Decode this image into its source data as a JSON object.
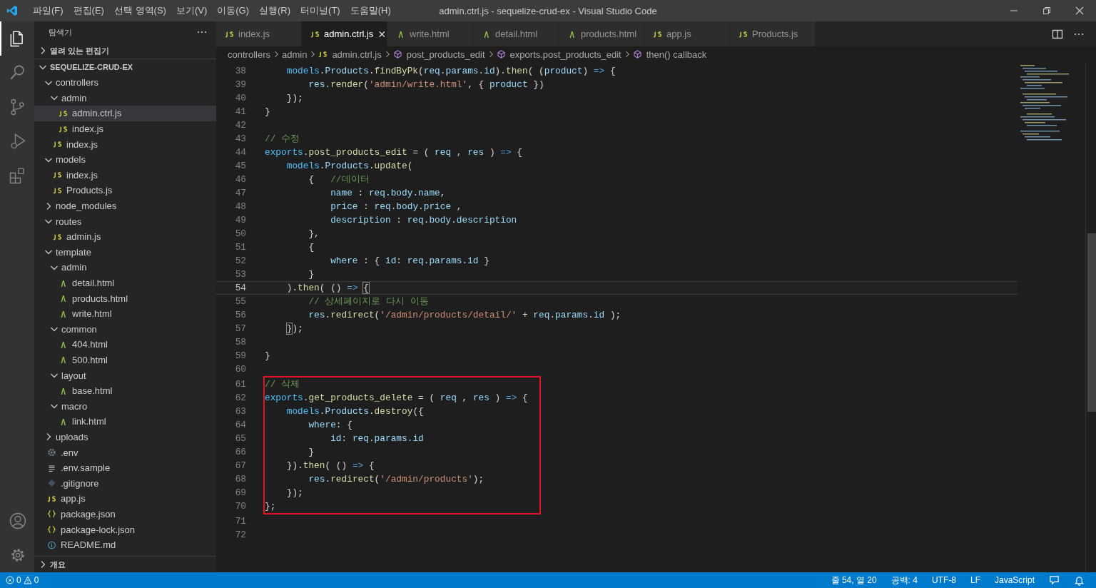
{
  "window": {
    "title": "admin.ctrl.js - sequelize-crud-ex - Visual Studio Code"
  },
  "menu": [
    "파일(F)",
    "편집(E)",
    "선택 영역(S)",
    "보기(V)",
    "이동(G)",
    "실행(R)",
    "터미널(T)",
    "도움말(H)"
  ],
  "activity_bar": [
    {
      "kind": "files",
      "selected": true
    },
    {
      "kind": "search",
      "selected": false
    },
    {
      "kind": "source-control",
      "selected": false
    },
    {
      "kind": "run",
      "selected": false
    },
    {
      "kind": "extensions",
      "selected": false
    }
  ],
  "activity_bottom": [
    {
      "kind": "account"
    },
    {
      "kind": "settings"
    }
  ],
  "sidebar": {
    "title": "탐색기",
    "open_editors": {
      "label": "열려 있는 편집기",
      "expanded": false
    },
    "root": {
      "label": "SEQUELIZE-CRUD-EX",
      "expanded": true
    },
    "items": [
      {
        "label": "controllers",
        "kind": "folder",
        "expanded": true,
        "selected": false,
        "children": [
          {
            "label": "admin",
            "kind": "folder",
            "expanded": true,
            "selected": false,
            "children": [
              {
                "label": "admin.ctrl.js",
                "kind": "js",
                "selected": true
              },
              {
                "label": "index.js",
                "kind": "js",
                "selected": false
              }
            ]
          },
          {
            "label": "index.js",
            "kind": "js",
            "selected": false
          }
        ]
      },
      {
        "label": "models",
        "kind": "folder",
        "expanded": true,
        "selected": false,
        "children": [
          {
            "label": "index.js",
            "kind": "js",
            "selected": false
          },
          {
            "label": "Products.js",
            "kind": "js",
            "selected": false
          }
        ]
      },
      {
        "label": "node_modules",
        "kind": "folder",
        "expanded": false,
        "selected": false
      },
      {
        "label": "routes",
        "kind": "folder",
        "expanded": true,
        "selected": false,
        "children": [
          {
            "label": "admin.js",
            "kind": "js",
            "selected": false
          }
        ]
      },
      {
        "label": "template",
        "kind": "folder",
        "expanded": true,
        "selected": false,
        "children": [
          {
            "label": "admin",
            "kind": "folder",
            "expanded": true,
            "selected": false,
            "children": [
              {
                "label": "detail.html",
                "kind": "html",
                "selected": false
              },
              {
                "label": "products.html",
                "kind": "html",
                "selected": false
              },
              {
                "label": "write.html",
                "kind": "html",
                "selected": false
              }
            ]
          },
          {
            "label": "common",
            "kind": "folder",
            "expanded": true,
            "selected": false,
            "children": [
              {
                "label": "404.html",
                "kind": "html",
                "selected": false
              },
              {
                "label": "500.html",
                "kind": "html",
                "selected": false
              }
            ]
          },
          {
            "label": "layout",
            "kind": "folder",
            "expanded": true,
            "selected": false,
            "children": [
              {
                "label": "base.html",
                "kind": "html",
                "selected": false
              }
            ]
          },
          {
            "label": "macro",
            "kind": "folder",
            "expanded": true,
            "selected": false,
            "children": [
              {
                "label": "link.html",
                "kind": "html",
                "selected": false
              }
            ]
          }
        ]
      },
      {
        "label": "uploads",
        "kind": "folder",
        "expanded": false,
        "selected": false
      },
      {
        "label": ".env",
        "kind": "gear",
        "selected": false
      },
      {
        "label": ".env.sample",
        "kind": "lines",
        "selected": false
      },
      {
        "label": ".gitignore",
        "kind": "git",
        "selected": false
      },
      {
        "label": "app.js",
        "kind": "js",
        "selected": false
      },
      {
        "label": "package.json",
        "kind": "json",
        "selected": false
      },
      {
        "label": "package-lock.json",
        "kind": "json",
        "selected": false
      },
      {
        "label": "README.md",
        "kind": "info",
        "selected": false
      }
    ],
    "outline": {
      "label": "개요",
      "expanded": false
    }
  },
  "tabs": [
    {
      "label": "index.js",
      "kind": "js",
      "selected": false
    },
    {
      "label": "admin.ctrl.js",
      "kind": "js",
      "selected": true
    },
    {
      "label": "write.html",
      "kind": "html",
      "selected": false
    },
    {
      "label": "detail.html",
      "kind": "html",
      "selected": false
    },
    {
      "label": "products.html",
      "kind": "html",
      "selected": false
    },
    {
      "label": "app.js",
      "kind": "js",
      "selected": false
    },
    {
      "label": "Products.js",
      "kind": "js",
      "selected": false
    }
  ],
  "breadcrumbs": [
    {
      "label": "controllers",
      "kind": "none"
    },
    {
      "label": "admin",
      "kind": "none"
    },
    {
      "label": "admin.ctrl.js",
      "kind": "js"
    },
    {
      "label": "post_products_edit",
      "kind": "symbol"
    },
    {
      "label": "exports.post_products_edit",
      "kind": "symbol"
    },
    {
      "label": "then() callback",
      "kind": "symbol"
    }
  ],
  "code_blocks": [
    {
      "boxed": false,
      "lines": [
        {
          "no": "38",
          "current": false,
          "tokens": [
            {
              "text": "    models",
              "kind": "obj"
            },
            {
              "text": ".",
              "kind": "plain"
            },
            {
              "text": "Products",
              "kind": "var"
            },
            {
              "text": ".",
              "kind": "plain"
            },
            {
              "text": "findByPk",
              "kind": "fn"
            },
            {
              "text": "(",
              "kind": "plain"
            },
            {
              "text": "req",
              "kind": "var"
            },
            {
              "text": ".",
              "kind": "plain"
            },
            {
              "text": "params",
              "kind": "var"
            },
            {
              "text": ".",
              "kind": "plain"
            },
            {
              "text": "id",
              "kind": "var"
            },
            {
              "text": ").",
              "kind": "plain"
            },
            {
              "text": "then",
              "kind": "fn"
            },
            {
              "text": "( (",
              "kind": "plain"
            },
            {
              "text": "product",
              "kind": "var"
            },
            {
              "text": ") ",
              "kind": "plain"
            },
            {
              "text": "=>",
              "kind": "op"
            },
            {
              "text": " {",
              "kind": "plain"
            }
          ]
        },
        {
          "no": "39",
          "current": false,
          "tokens": [
            {
              "text": "        res",
              "kind": "var"
            },
            {
              "text": ".",
              "kind": "plain"
            },
            {
              "text": "render",
              "kind": "fn"
            },
            {
              "text": "(",
              "kind": "plain"
            },
            {
              "text": "'admin/write.html'",
              "kind": "str"
            },
            {
              "text": ", { ",
              "kind": "plain"
            },
            {
              "text": "product",
              "kind": "var"
            },
            {
              "text": " })",
              "kind": "plain"
            }
          ]
        },
        {
          "no": "40",
          "current": false,
          "tokens": [
            {
              "text": "    });",
              "kind": "plain"
            }
          ]
        },
        {
          "no": "41",
          "current": false,
          "tokens": [
            {
              "text": "}",
              "kind": "plain"
            }
          ]
        },
        {
          "no": "42",
          "current": false
        },
        {
          "no": "43",
          "current": false,
          "tokens": [
            {
              "text": "// 수정",
              "kind": "cmt"
            }
          ]
        },
        {
          "no": "44",
          "current": false,
          "tokens": [
            {
              "text": "exports",
              "kind": "obj"
            },
            {
              "text": ".",
              "kind": "plain"
            },
            {
              "text": "post_products_edit",
              "kind": "fn"
            },
            {
              "text": " = ( ",
              "kind": "plain"
            },
            {
              "text": "req",
              "kind": "var"
            },
            {
              "text": " , ",
              "kind": "plain"
            },
            {
              "text": "res",
              "kind": "var"
            },
            {
              "text": " ) ",
              "kind": "plain"
            },
            {
              "text": "=>",
              "kind": "op"
            },
            {
              "text": " {",
              "kind": "plain"
            }
          ]
        },
        {
          "no": "45",
          "current": false,
          "tokens": [
            {
              "text": "    models",
              "kind": "obj"
            },
            {
              "text": ".",
              "kind": "plain"
            },
            {
              "text": "Products",
              "kind": "var"
            },
            {
              "text": ".",
              "kind": "plain"
            },
            {
              "text": "update",
              "kind": "fn"
            },
            {
              "text": "(",
              "kind": "plain"
            }
          ]
        },
        {
          "no": "46",
          "current": false,
          "tokens": [
            {
              "text": "        {   ",
              "kind": "plain"
            },
            {
              "text": "//데이터",
              "kind": "cmt"
            }
          ]
        },
        {
          "no": "47",
          "current": false,
          "tokens": [
            {
              "text": "            name",
              "kind": "var"
            },
            {
              "text": " : ",
              "kind": "plain"
            },
            {
              "text": "req",
              "kind": "var"
            },
            {
              "text": ".",
              "kind": "plain"
            },
            {
              "text": "body",
              "kind": "var"
            },
            {
              "text": ".",
              "kind": "plain"
            },
            {
              "text": "name",
              "kind": "var"
            },
            {
              "text": ",",
              "kind": "plain"
            }
          ]
        },
        {
          "no": "48",
          "current": false,
          "tokens": [
            {
              "text": "            price",
              "kind": "var"
            },
            {
              "text": " : ",
              "kind": "plain"
            },
            {
              "text": "req",
              "kind": "var"
            },
            {
              "text": ".",
              "kind": "plain"
            },
            {
              "text": "body",
              "kind": "var"
            },
            {
              "text": ".",
              "kind": "plain"
            },
            {
              "text": "price",
              "kind": "var"
            },
            {
              "text": " ,",
              "kind": "plain"
            }
          ]
        },
        {
          "no": "49",
          "current": false,
          "tokens": [
            {
              "text": "            description",
              "kind": "var"
            },
            {
              "text": " : ",
              "kind": "plain"
            },
            {
              "text": "req",
              "kind": "var"
            },
            {
              "text": ".",
              "kind": "plain"
            },
            {
              "text": "body",
              "kind": "var"
            },
            {
              "text": ".",
              "kind": "plain"
            },
            {
              "text": "description",
              "kind": "var"
            }
          ]
        },
        {
          "no": "50",
          "current": false,
          "tokens": [
            {
              "text": "        },",
              "kind": "plain"
            }
          ]
        },
        {
          "no": "51",
          "current": false,
          "tokens": [
            {
              "text": "        {",
              "kind": "plain"
            }
          ]
        },
        {
          "no": "52",
          "current": false,
          "tokens": [
            {
              "text": "            where",
              "kind": "var"
            },
            {
              "text": " : { ",
              "kind": "plain"
            },
            {
              "text": "id",
              "kind": "var"
            },
            {
              "text": ": ",
              "kind": "plain"
            },
            {
              "text": "req",
              "kind": "var"
            },
            {
              "text": ".",
              "kind": "plain"
            },
            {
              "text": "params",
              "kind": "var"
            },
            {
              "text": ".",
              "kind": "plain"
            },
            {
              "text": "id",
              "kind": "var"
            },
            {
              "text": " }",
              "kind": "plain"
            }
          ]
        },
        {
          "no": "53",
          "current": false,
          "tokens": [
            {
              "text": "        }",
              "kind": "plain"
            }
          ]
        },
        {
          "no": "54",
          "current": true,
          "tokens": [
            {
              "text": "    ).",
              "kind": "plain"
            },
            {
              "text": "then",
              "kind": "fn"
            },
            {
              "text": "( () ",
              "kind": "plain"
            },
            {
              "text": "=> ",
              "kind": "op"
            },
            {
              "text": "{",
              "kind": "bracket"
            }
          ]
        },
        {
          "no": "55",
          "current": false,
          "tokens": [
            {
              "text": "        // 상세페이지로 다시 이동",
              "kind": "cmt"
            }
          ]
        },
        {
          "no": "56",
          "current": false,
          "tokens": [
            {
              "text": "        res",
              "kind": "var"
            },
            {
              "text": ".",
              "kind": "plain"
            },
            {
              "text": "redirect",
              "kind": "fn"
            },
            {
              "text": "(",
              "kind": "plain"
            },
            {
              "text": "'/admin/products/detail/'",
              "kind": "str"
            },
            {
              "text": " + ",
              "kind": "plain"
            },
            {
              "text": "req",
              "kind": "var"
            },
            {
              "text": ".",
              "kind": "plain"
            },
            {
              "text": "params",
              "kind": "var"
            },
            {
              "text": ".",
              "kind": "plain"
            },
            {
              "text": "id",
              "kind": "var"
            },
            {
              "text": " );",
              "kind": "plain"
            }
          ]
        },
        {
          "no": "57",
          "current": false,
          "tokens": [
            {
              "text": "    }",
              "kind": "bracket"
            },
            {
              "text": ");",
              "kind": "plain"
            }
          ]
        },
        {
          "no": "58",
          "current": false
        },
        {
          "no": "59",
          "current": false,
          "tokens": [
            {
              "text": "}",
              "kind": "plain"
            }
          ]
        },
        {
          "no": "60",
          "current": false
        }
      ]
    },
    {
      "boxed": true,
      "lines": [
        {
          "no": "61",
          "current": false,
          "tokens": [
            {
              "text": "// 삭제",
              "kind": "cmt"
            }
          ]
        },
        {
          "no": "62",
          "current": false,
          "tokens": [
            {
              "text": "exports",
              "kind": "obj"
            },
            {
              "text": ".",
              "kind": "plain"
            },
            {
              "text": "get_products_delete",
              "kind": "fn"
            },
            {
              "text": " = ( ",
              "kind": "plain"
            },
            {
              "text": "req",
              "kind": "var"
            },
            {
              "text": " , ",
              "kind": "plain"
            },
            {
              "text": "res",
              "kind": "var"
            },
            {
              "text": " ) ",
              "kind": "plain"
            },
            {
              "text": "=>",
              "kind": "op"
            },
            {
              "text": " {",
              "kind": "plain"
            }
          ]
        },
        {
          "no": "63",
          "current": false,
          "tokens": [
            {
              "text": "    models",
              "kind": "obj"
            },
            {
              "text": ".",
              "kind": "plain"
            },
            {
              "text": "Products",
              "kind": "var"
            },
            {
              "text": ".",
              "kind": "plain"
            },
            {
              "text": "destroy",
              "kind": "fn"
            },
            {
              "text": "({",
              "kind": "plain"
            }
          ]
        },
        {
          "no": "64",
          "current": false,
          "tokens": [
            {
              "text": "        where",
              "kind": "var"
            },
            {
              "text": ": {",
              "kind": "plain"
            }
          ]
        },
        {
          "no": "65",
          "current": false,
          "tokens": [
            {
              "text": "            id",
              "kind": "var"
            },
            {
              "text": ": ",
              "kind": "plain"
            },
            {
              "text": "req",
              "kind": "var"
            },
            {
              "text": ".",
              "kind": "plain"
            },
            {
              "text": "params",
              "kind": "var"
            },
            {
              "text": ".",
              "kind": "plain"
            },
            {
              "text": "id",
              "kind": "var"
            }
          ]
        },
        {
          "no": "66",
          "current": false,
          "tokens": [
            {
              "text": "        }",
              "kind": "plain"
            }
          ]
        },
        {
          "no": "67",
          "current": false,
          "tokens": [
            {
              "text": "    }).",
              "kind": "plain"
            },
            {
              "text": "then",
              "kind": "fn"
            },
            {
              "text": "( () ",
              "kind": "plain"
            },
            {
              "text": "=>",
              "kind": "op"
            },
            {
              "text": " {",
              "kind": "plain"
            }
          ]
        },
        {
          "no": "68",
          "current": false,
          "tokens": [
            {
              "text": "        res",
              "kind": "var"
            },
            {
              "text": ".",
              "kind": "plain"
            },
            {
              "text": "redirect",
              "kind": "fn"
            },
            {
              "text": "(",
              "kind": "plain"
            },
            {
              "text": "'/admin/products'",
              "kind": "str"
            },
            {
              "text": ");",
              "kind": "plain"
            }
          ]
        },
        {
          "no": "69",
          "current": false,
          "tokens": [
            {
              "text": "    });",
              "kind": "plain"
            }
          ]
        },
        {
          "no": "70",
          "current": false,
          "tokens": [
            {
              "text": "};",
              "kind": "plain"
            }
          ]
        }
      ]
    },
    {
      "boxed": false,
      "lines": [
        {
          "no": "71",
          "current": false
        },
        {
          "no": "72",
          "current": false
        }
      ]
    }
  ],
  "status_bar": {
    "errors": "0",
    "warnings": "0",
    "right": [
      "줄 54, 열 20",
      "공백: 4",
      "UTF-8",
      "LF",
      "JavaScript"
    ]
  }
}
